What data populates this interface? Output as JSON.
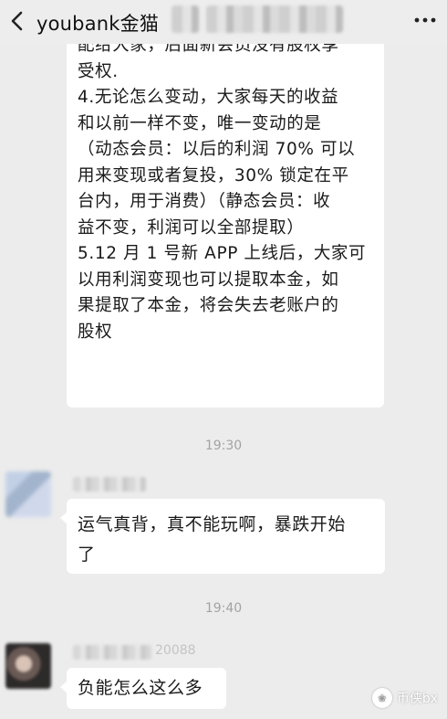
{
  "header": {
    "title": "youbank金猫"
  },
  "messages": [
    {
      "lines": [
        "配给大家，后面新会员没有股权享",
        "受权.",
        "4.无论怎么变动，大家每天的收益",
        "和以前一样不变，唯一变动的是",
        "（动态会员：以后的利润 70% 可以",
        "用来变现或者复投，30% 锁定在平",
        "台内，用于消费）（静态会员：收",
        "益不变，利润可以全部提取）",
        "5.12 月 1 号新 APP 上线后，大家可",
        "以用利润变现也可以提取本金，如",
        "果提取了本金，将会失去老账户的",
        "股权"
      ]
    },
    {
      "time": "19:30",
      "lines": [
        "运气真背，真不能玩啊，暴跌开始",
        "了"
      ]
    },
    {
      "time": "19:40",
      "nick_tail": "20088",
      "lines": [
        "负能怎么这么多"
      ]
    }
  ],
  "watermark": {
    "text": "币侠bx"
  },
  "colors": {
    "background": "#ececec",
    "bubble": "#ffffff",
    "time": "#a3a3a3"
  }
}
